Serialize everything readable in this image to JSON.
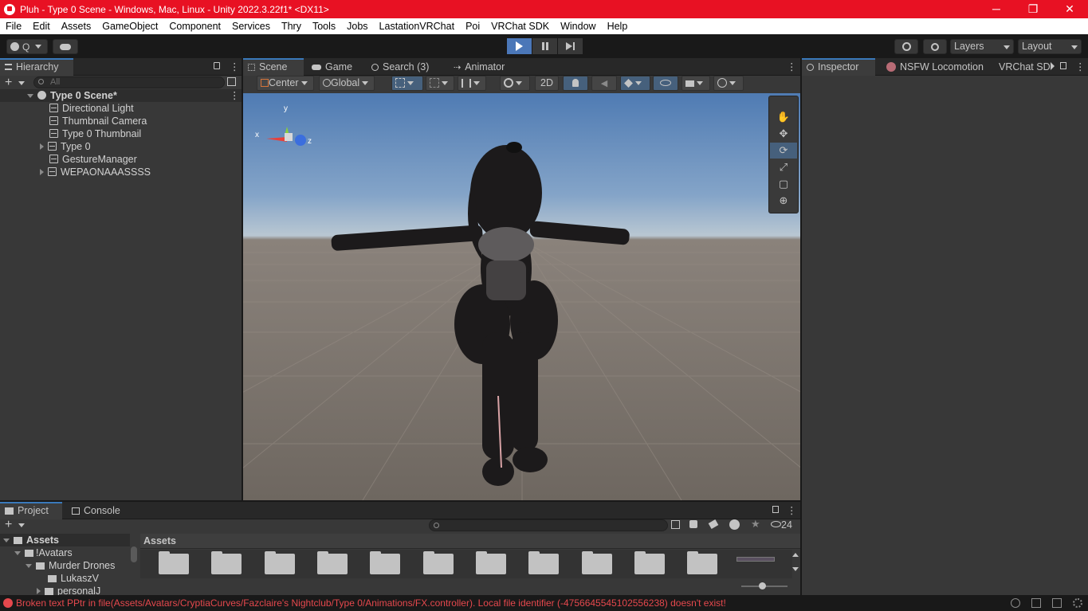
{
  "window": {
    "title": "Pluh - Type 0 Scene - Windows, Mac, Linux - Unity 2022.3.22f1* <DX11>",
    "controls": [
      "─",
      "❐",
      "✕"
    ]
  },
  "menu": [
    "File",
    "Edit",
    "Assets",
    "GameObject",
    "Component",
    "Services",
    "Thry",
    "Tools",
    "Jobs",
    "LastationVRChat",
    "Poi",
    "VRChat SDK",
    "Window",
    "Help"
  ],
  "toolbar": {
    "account_label": "Q",
    "layers_label": "Layers",
    "layout_label": "Layout"
  },
  "hierarchy": {
    "tab_label": "Hierarchy",
    "search_placeholder": "All",
    "scene_name": "Type 0 Scene*",
    "items": [
      {
        "label": "Directional Light"
      },
      {
        "label": "Thumbnail Camera"
      },
      {
        "label": "Type 0 Thumbnail"
      },
      {
        "label": "Type 0"
      },
      {
        "label": "GestureManager"
      },
      {
        "label": "WEPAONAAASSSS"
      }
    ]
  },
  "scene_tabs": [
    "Scene",
    "Game",
    "Search (3)",
    "Animator"
  ],
  "scene_toolbar": {
    "pivot": "Center",
    "space": "Global",
    "mode_2d": "2D"
  },
  "gizmo": {
    "x": "x",
    "y": "y",
    "z": "z"
  },
  "inspector_tabs": [
    "Inspector",
    "NSFW Locomotion",
    "VRChat SDK"
  ],
  "project": {
    "tabs": [
      "Project",
      "Console"
    ],
    "breadcrumb": "Assets",
    "hidden_count": "24",
    "tree": [
      {
        "label": "Assets",
        "level": 0
      },
      {
        "label": "!Avatars",
        "level": 1
      },
      {
        "label": "Murder Drones",
        "level": 2
      },
      {
        "label": "LukaszV",
        "level": 3
      },
      {
        "label": "personalJ",
        "level": 3
      }
    ]
  },
  "status": {
    "message": "Broken text PPtr in file(Assets/Avatars/CryptiaCurves/Fazclaire's Nightclub/Type 0/Animations/FX.controller). Local file identifier (-4756645545102556238) doesn't exist!",
    "color": "#e5484d"
  },
  "colors": {
    "titlebar": "#e81123",
    "accent": "#3a79bb",
    "play_active": "#4b77b8"
  }
}
